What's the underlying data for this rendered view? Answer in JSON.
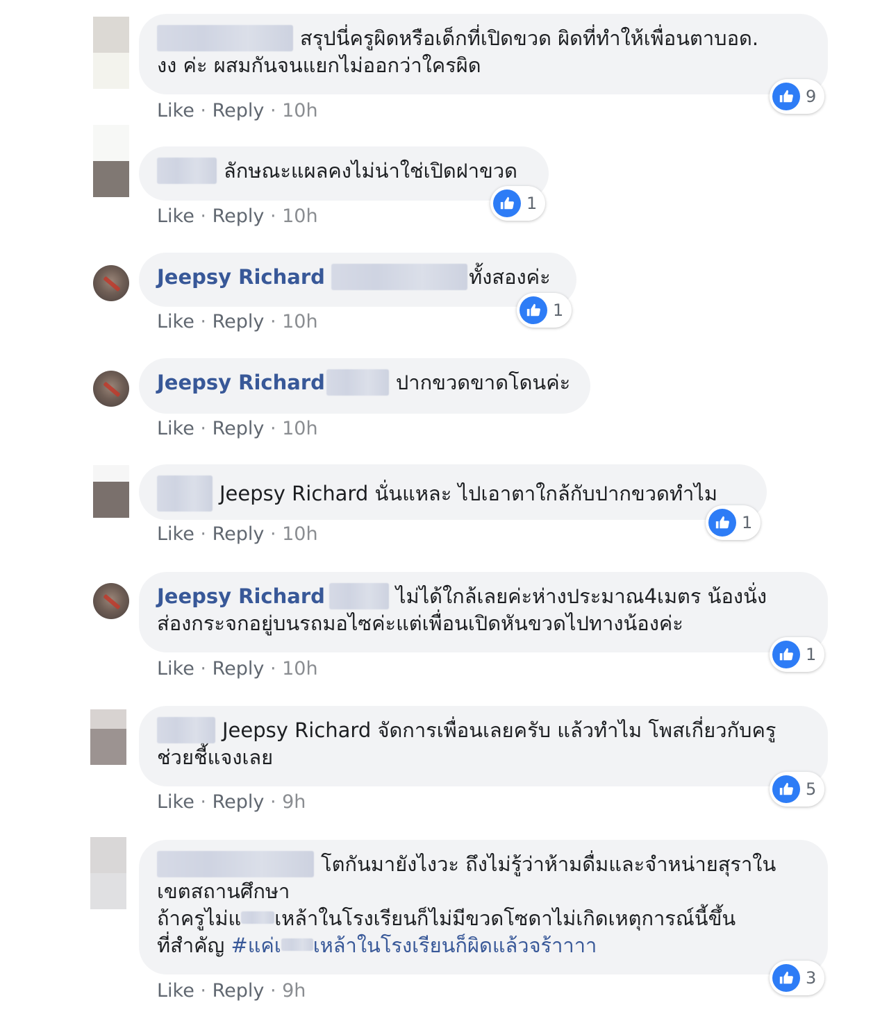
{
  "action_labels": {
    "like": "Like",
    "reply": "Reply",
    "separator": " · "
  },
  "comments": [
    {
      "lines": [
        "สรุปนี่ครูผิดหรือเด็กที่เปิดขวด ผิดที่ทำให้เพื่อนตาบอด.",
        "งง ค่ะ ผสมกันจนแยกไม่ออกว่าใครผิด"
      ],
      "time": "10h",
      "reactions": "9"
    },
    {
      "lines": [
        "ลักษณะแผลคงไม่น่าใช่เปิดฝาขวด"
      ],
      "time": "10h",
      "reactions": "1"
    },
    {
      "name": "Jeepsy Richard",
      "lines": [
        "ทั้งสองค่ะ"
      ],
      "time": "10h",
      "reactions": "1"
    },
    {
      "name": "Jeepsy Richard",
      "lines": [
        "ปากขวดขาดโดนค่ะ"
      ],
      "time": "10h"
    },
    {
      "lines": [
        "Jeepsy Richard นั่นแหละ ไปเอาตาใกล้กับปากขวดทำไม"
      ],
      "time": "10h",
      "reactions": "1"
    },
    {
      "name": "Jeepsy Richard",
      "lines": [
        "ไม่ได้ใกล้เลยค่ะห่างประมาณ4เมตร น้องนั่ง",
        "ส่องกระจกอยู่บนรถมอไซค่ะแต่เพื่อนเปิดหันขวดไปทางน้องค่ะ"
      ],
      "time": "10h",
      "reactions": "1"
    },
    {
      "lines": [
        "Jeepsy Richard จัดการเพื่อนเลยครับ แล้วทำไม โพสเกี่ยวกับครู",
        "ช่วยชี้แจงเลย"
      ],
      "time": "9h",
      "reactions": "5"
    },
    {
      "lines": [
        "โตกันมายังไงวะ ถึงไม่รู้ว่าห้ามดื่มและจำหน่ายสุราใน",
        "เขตสถานศึกษา",
        "ถ้าครูไม่แ",
        "เหล้าในโรงเรียนก็ไม่มีขวดโซดาไม่เกิดเหตุการณ์นี้ขึ้น",
        "ที่สำคัญ ",
        "#แค่เ",
        "เหล้าในโรงเรียนก็ผิดแล้วจร้าาาา"
      ],
      "time": "9h",
      "reactions": "3"
    }
  ]
}
